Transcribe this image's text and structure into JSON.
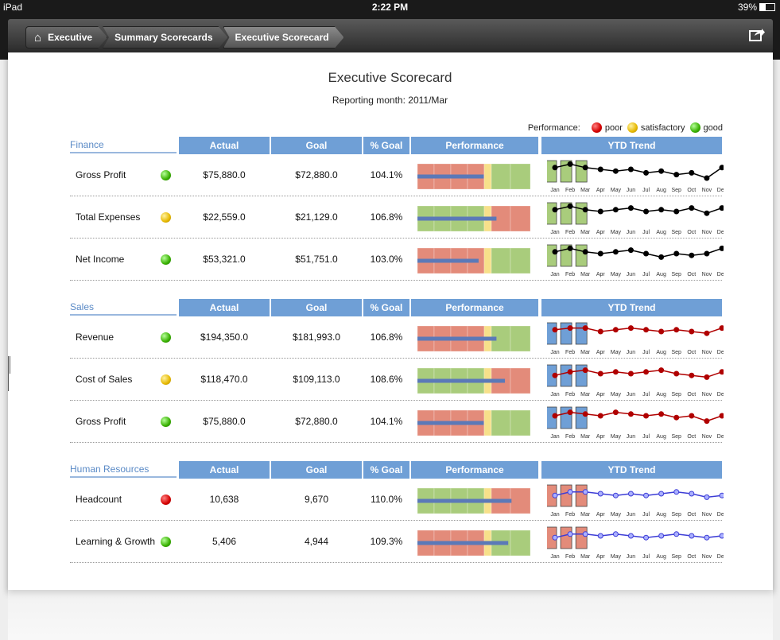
{
  "status_bar": {
    "device": "iPad",
    "time": "2:22 PM",
    "battery": "39%"
  },
  "breadcrumbs": [
    {
      "label": "Executive",
      "name": "breadcrumb-executive",
      "icon": "home-icon"
    },
    {
      "label": "Summary Scorecards",
      "name": "breadcrumb-summary-scorecards"
    },
    {
      "label": "Executive Scorecard",
      "name": "breadcrumb-executive-scorecard"
    }
  ],
  "page": {
    "title": "Executive Scorecard",
    "subtitle": "Reporting month: 2011/Mar"
  },
  "legend": {
    "label": "Performance:",
    "items": [
      {
        "label": "poor",
        "status": "poor"
      },
      {
        "label": "satisfactory",
        "status": "satisfactory"
      },
      {
        "label": "good",
        "status": "good"
      }
    ]
  },
  "columns": {
    "actual": "Actual",
    "goal": "Goal",
    "pct": "% Goal",
    "performance": "Performance",
    "trend": "YTD Trend"
  },
  "months": [
    "Jan",
    "Feb",
    "Mar",
    "Apr",
    "May",
    "Jun",
    "Jul",
    "Aug",
    "Sep",
    "Oct",
    "Nov",
    "Dec"
  ],
  "colors": {
    "header_blue": "#6f9fd6",
    "bar_green": "#a9cc7c",
    "bar_red": "#e38b7a",
    "bar_yellow": "#f7e08a",
    "measure_blue": "#5b79b8",
    "finance_bar": "#a9cc7c",
    "sales_bar": "#6f9fd6",
    "hr_bar": "#e38b7a",
    "finance_line": "#000000",
    "sales_line": "#b00000",
    "hr_line": "#3d3dd6"
  },
  "sections": [
    {
      "name": "Finance",
      "theme": "finance",
      "rows": [
        {
          "name": "Gross Profit",
          "status": "good",
          "actual": "$75,880.0",
          "goal": "$72,880.0",
          "pct": "104.1%",
          "pct_value": 104.1,
          "bands": [
            "red",
            "red",
            "red",
            "red",
            "yellow",
            "green",
            "green"
          ],
          "trend": [
            92,
            96,
            92,
            90,
            88,
            90,
            86,
            88,
            84,
            86,
            80,
            92
          ]
        },
        {
          "name": "Total Expenses",
          "status": "satisfactory",
          "actual": "$22,559.0",
          "goal": "$21,129.0",
          "pct": "106.8%",
          "pct_value": 106.8,
          "bands": [
            "green",
            "green",
            "green",
            "green",
            "yellow",
            "red",
            "red"
          ],
          "trend": [
            92,
            96,
            92,
            90,
            92,
            94,
            90,
            92,
            90,
            94,
            88,
            94
          ]
        },
        {
          "name": "Net Income",
          "status": "good",
          "actual": "$53,321.0",
          "goal": "$51,751.0",
          "pct": "103.0%",
          "pct_value": 103.0,
          "bands": [
            "red",
            "red",
            "red",
            "red",
            "yellow",
            "green",
            "green"
          ],
          "trend": [
            92,
            96,
            92,
            90,
            92,
            94,
            90,
            86,
            90,
            88,
            90,
            96
          ]
        }
      ]
    },
    {
      "name": "Sales",
      "theme": "sales",
      "rows": [
        {
          "name": "Revenue",
          "status": "good",
          "actual": "$194,350.0",
          "goal": "$181,993.0",
          "pct": "106.8%",
          "pct_value": 106.8,
          "bands": [
            "red",
            "red",
            "red",
            "red",
            "yellow",
            "green",
            "green"
          ],
          "trend": [
            92,
            94,
            94,
            90,
            92,
            94,
            92,
            90,
            92,
            90,
            88,
            94
          ]
        },
        {
          "name": "Cost of Sales",
          "status": "satisfactory",
          "actual": "$118,470.0",
          "goal": "$109,113.0",
          "pct": "108.6%",
          "pct_value": 108.6,
          "bands": [
            "green",
            "green",
            "green",
            "green",
            "yellow",
            "red",
            "red"
          ],
          "trend": [
            88,
            92,
            94,
            90,
            92,
            90,
            92,
            94,
            90,
            88,
            86,
            92
          ]
        },
        {
          "name": "Gross Profit",
          "status": "good",
          "actual": "$75,880.0",
          "goal": "$72,880.0",
          "pct": "104.1%",
          "pct_value": 104.1,
          "bands": [
            "red",
            "red",
            "red",
            "red",
            "yellow",
            "green",
            "green"
          ],
          "trend": [
            90,
            94,
            92,
            90,
            94,
            92,
            90,
            92,
            88,
            90,
            84,
            90
          ]
        }
      ]
    },
    {
      "name": "Human Resources",
      "theme": "hr",
      "rows": [
        {
          "name": "Headcount",
          "status": "poor",
          "actual": "10,638",
          "goal": "9,670",
          "pct": "110.0%",
          "pct_value": 110.0,
          "bands": [
            "green",
            "green",
            "green",
            "green",
            "yellow",
            "red",
            "red"
          ],
          "trend": [
            88,
            92,
            92,
            90,
            88,
            90,
            88,
            90,
            92,
            90,
            86,
            88
          ]
        },
        {
          "name": "Learning & Growth",
          "status": "good",
          "actual": "5,406",
          "goal": "4,944",
          "pct": "109.3%",
          "pct_value": 109.3,
          "bands": [
            "red",
            "red",
            "red",
            "red",
            "yellow",
            "green",
            "green"
          ],
          "trend": [
            88,
            92,
            92,
            90,
            92,
            90,
            88,
            90,
            92,
            90,
            88,
            90
          ]
        }
      ]
    }
  ]
}
